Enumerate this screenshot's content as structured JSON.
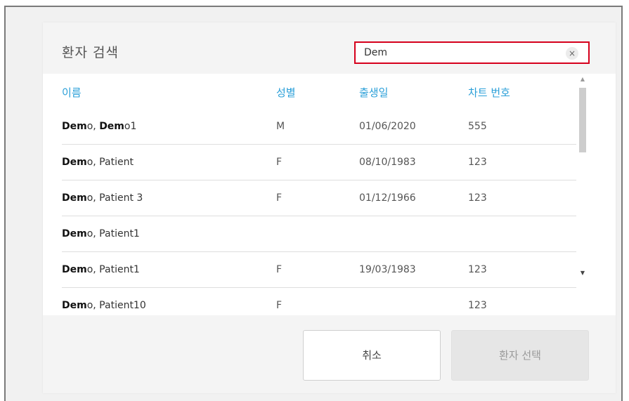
{
  "dialog": {
    "title": "환자 검색",
    "search": {
      "value": "Dem",
      "clear_label": "×"
    },
    "columns": {
      "name": "이름",
      "sex": "성별",
      "dob": "출생일",
      "chart": "차트 번호"
    },
    "rows": [
      {
        "name_bold": "Dem",
        "name_mid": "o, ",
        "name_bold2": "Dem",
        "name_rest": "o1",
        "sex": "M",
        "dob": "01/06/2020",
        "chart": "555"
      },
      {
        "name_bold": "Dem",
        "name_mid": "o, Patient",
        "name_bold2": "",
        "name_rest": "",
        "sex": "F",
        "dob": "08/10/1983",
        "chart": "123"
      },
      {
        "name_bold": "Dem",
        "name_mid": "o, Patient 3",
        "name_bold2": "",
        "name_rest": "",
        "sex": "F",
        "dob": "01/12/1966",
        "chart": "123"
      },
      {
        "name_bold": "Dem",
        "name_mid": "o, Patient1",
        "name_bold2": "",
        "name_rest": "",
        "sex": "",
        "dob": "",
        "chart": ""
      },
      {
        "name_bold": "Dem",
        "name_mid": "o, Patient1",
        "name_bold2": "",
        "name_rest": "",
        "sex": "F",
        "dob": "19/03/1983",
        "chart": "123"
      },
      {
        "name_bold": "Dem",
        "name_mid": "o, Patient10",
        "name_bold2": "",
        "name_rest": "",
        "sex": "F",
        "dob": "",
        "chart": "123"
      }
    ],
    "buttons": {
      "cancel": "취소",
      "select": "환자 선택"
    },
    "icons": {
      "scroll_up": "scroll-up-arrow-icon",
      "scroll_down": "scroll-down-arrow-icon",
      "clear": "clear-icon"
    }
  },
  "colors": {
    "accent": "#2a9fd8",
    "search_border": "#d6001c"
  }
}
